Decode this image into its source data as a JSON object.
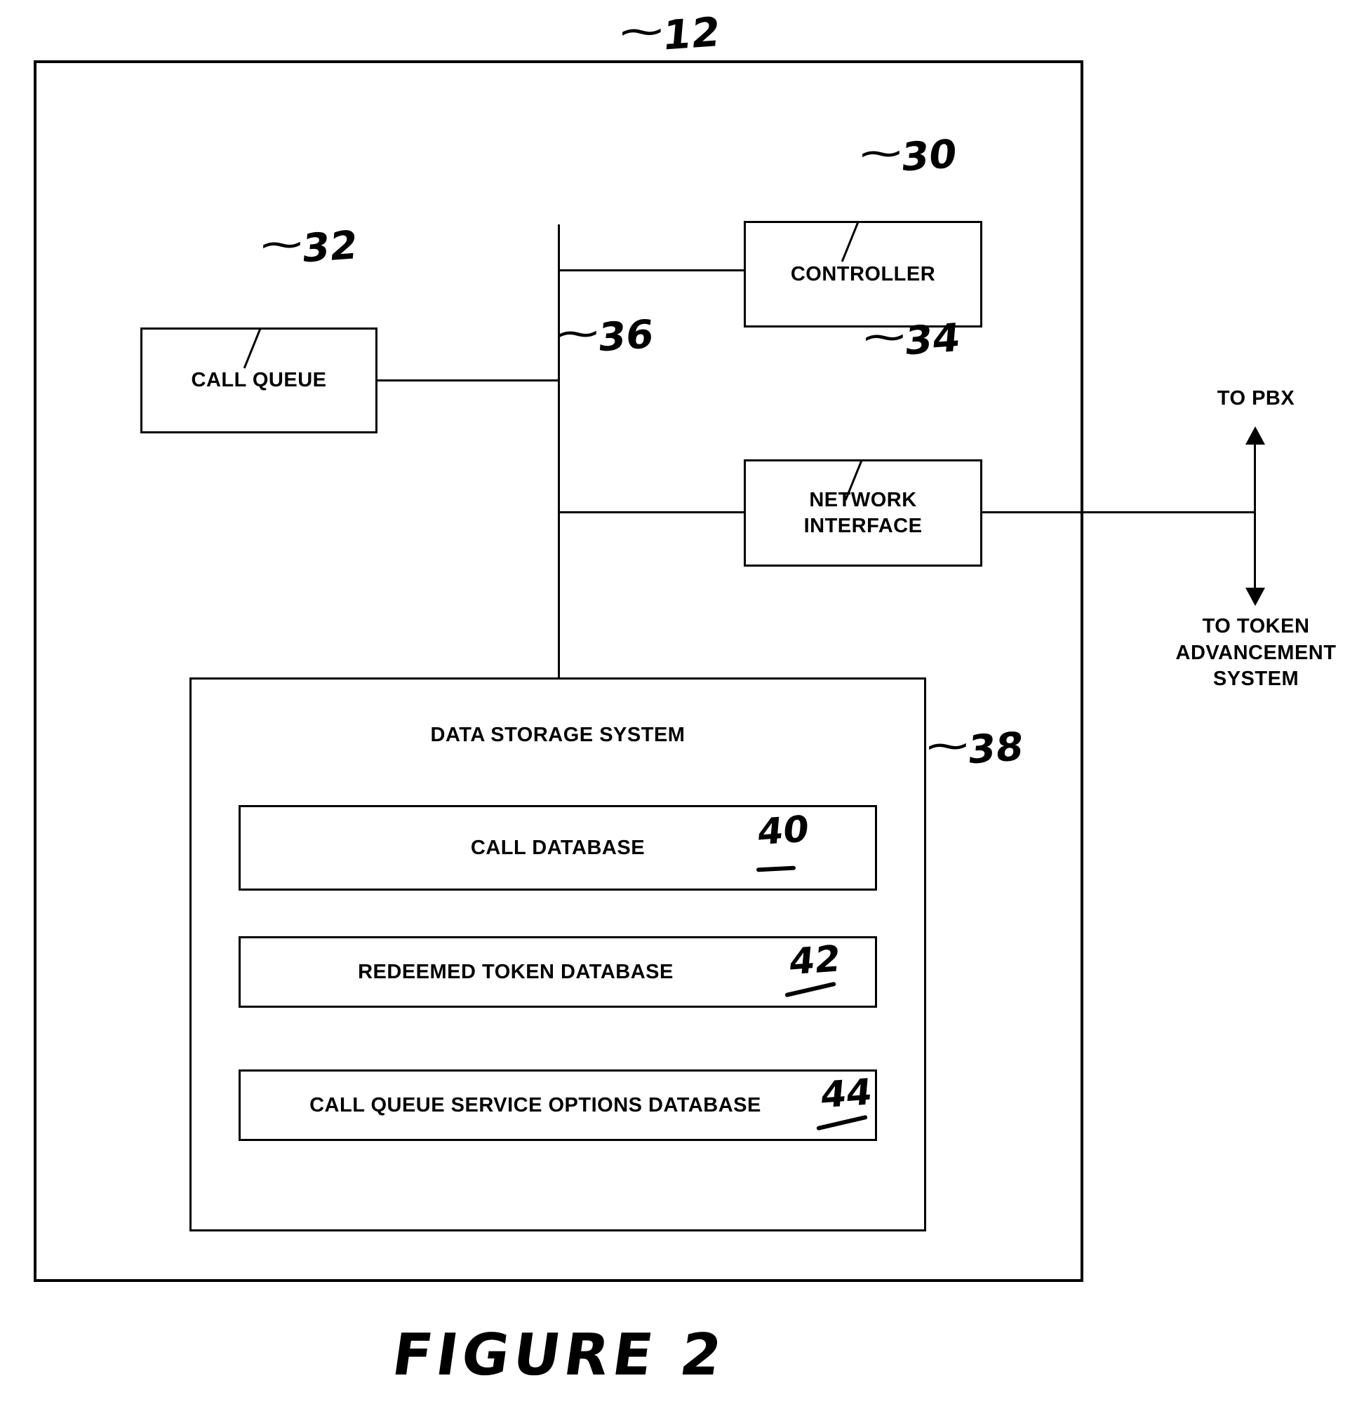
{
  "figure": {
    "caption": "FIGURE 2",
    "system_numeral": "12"
  },
  "blocks": {
    "controller": {
      "label": "CONTROLLER",
      "numeral": "30"
    },
    "call_queue": {
      "label": "CALL QUEUE",
      "numeral": "32"
    },
    "network_interface": {
      "label_line1": "NETWORK",
      "label_line2": "INTERFACE",
      "numeral": "34"
    },
    "bus": {
      "numeral": "36"
    },
    "data_storage_system": {
      "label": "DATA STORAGE SYSTEM",
      "numeral": "38"
    },
    "call_database": {
      "label": "CALL DATABASE",
      "numeral": "40"
    },
    "redeemed_token_database": {
      "label": "REDEEMED TOKEN DATABASE",
      "numeral": "42"
    },
    "call_queue_service_options_database": {
      "label": "CALL QUEUE SERVICE OPTIONS DATABASE",
      "numeral": "44"
    }
  },
  "external_labels": {
    "to_pbx": "TO PBX",
    "to_token_advancement_system_line1": "TO TOKEN",
    "to_token_advancement_system_line2": "ADVANCEMENT",
    "to_token_advancement_system_line3": "SYSTEM"
  },
  "colors": {
    "ink": "#000000",
    "paper": "#ffffff"
  }
}
